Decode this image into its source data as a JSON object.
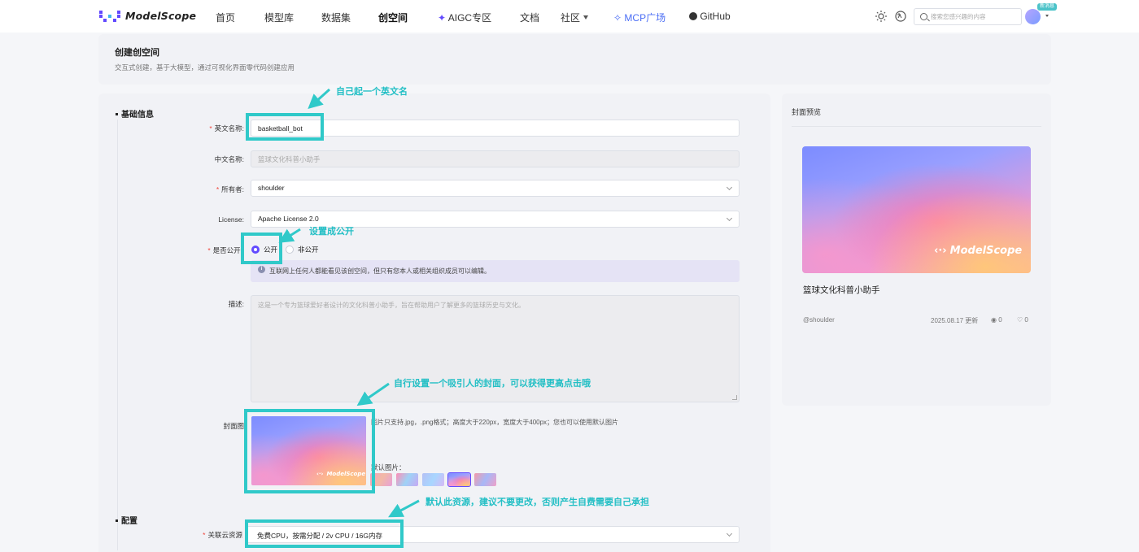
{
  "nav": {
    "brand": "ModelScope",
    "items": [
      "首页",
      "模型库",
      "数据集",
      "创空间",
      "AIGC专区",
      "文档",
      "社区",
      "MCP广场",
      "GitHub"
    ],
    "search_placeholder": "搜索您感兴趣的内容",
    "badge": "新消息"
  },
  "header": {
    "title": "创建创空间",
    "subtitle": "交互式创建，基于大模型，通过可视化界面零代码创建应用"
  },
  "form": {
    "section_basic": "基础信息",
    "section_config": "配置",
    "required_mark": "*",
    "english_name": {
      "label": "英文名称:",
      "value": "basketball_bot"
    },
    "chinese_name": {
      "label": "中文名称:",
      "value": "篮球文化科普小助手"
    },
    "owner": {
      "label": "所有者:",
      "value": "shoulder"
    },
    "license": {
      "label": "License:",
      "value": "Apache License 2.0"
    },
    "visibility": {
      "label": "是否公开:",
      "options": [
        "公开",
        "非公开"
      ],
      "notice_icon": "i",
      "notice": "互联网上任何人都能看见该创空间，但只有您本人或相关组织成员可以编辑。"
    },
    "description": {
      "label": "描述:",
      "value": "这是一个专为篮球爱好者设计的文化科普小助手，旨在帮助用户了解更多的篮球历史与文化。"
    },
    "cover": {
      "label": "封面图",
      "hint": "图片只支持.jpg，.png格式；高度大于220px，宽度大于400px；您也可以使用默认图片",
      "default_label": "默认图片："
    },
    "resource": {
      "label": "关联云资源",
      "value": "免费CPU，按需分配 / 2v CPU / 16G内存"
    }
  },
  "preview": {
    "title": "封面预览",
    "name": "篮球文化科普小助手",
    "owner": "@shoulder",
    "date": "2025.08.17 更新",
    "views": "0",
    "likes": "0"
  },
  "annotations": {
    "english_name": "自己起一个英文名",
    "public": "设置成公开",
    "cover": "自行设置一个吸引人的封面，可以获得更高点击哦",
    "resource": "默认此资源，建议不要更改，否则产生自费需要自己承担"
  },
  "colors": {
    "accent": "#624aff",
    "annotation": "#30c9c9",
    "required": "#f0443a"
  }
}
